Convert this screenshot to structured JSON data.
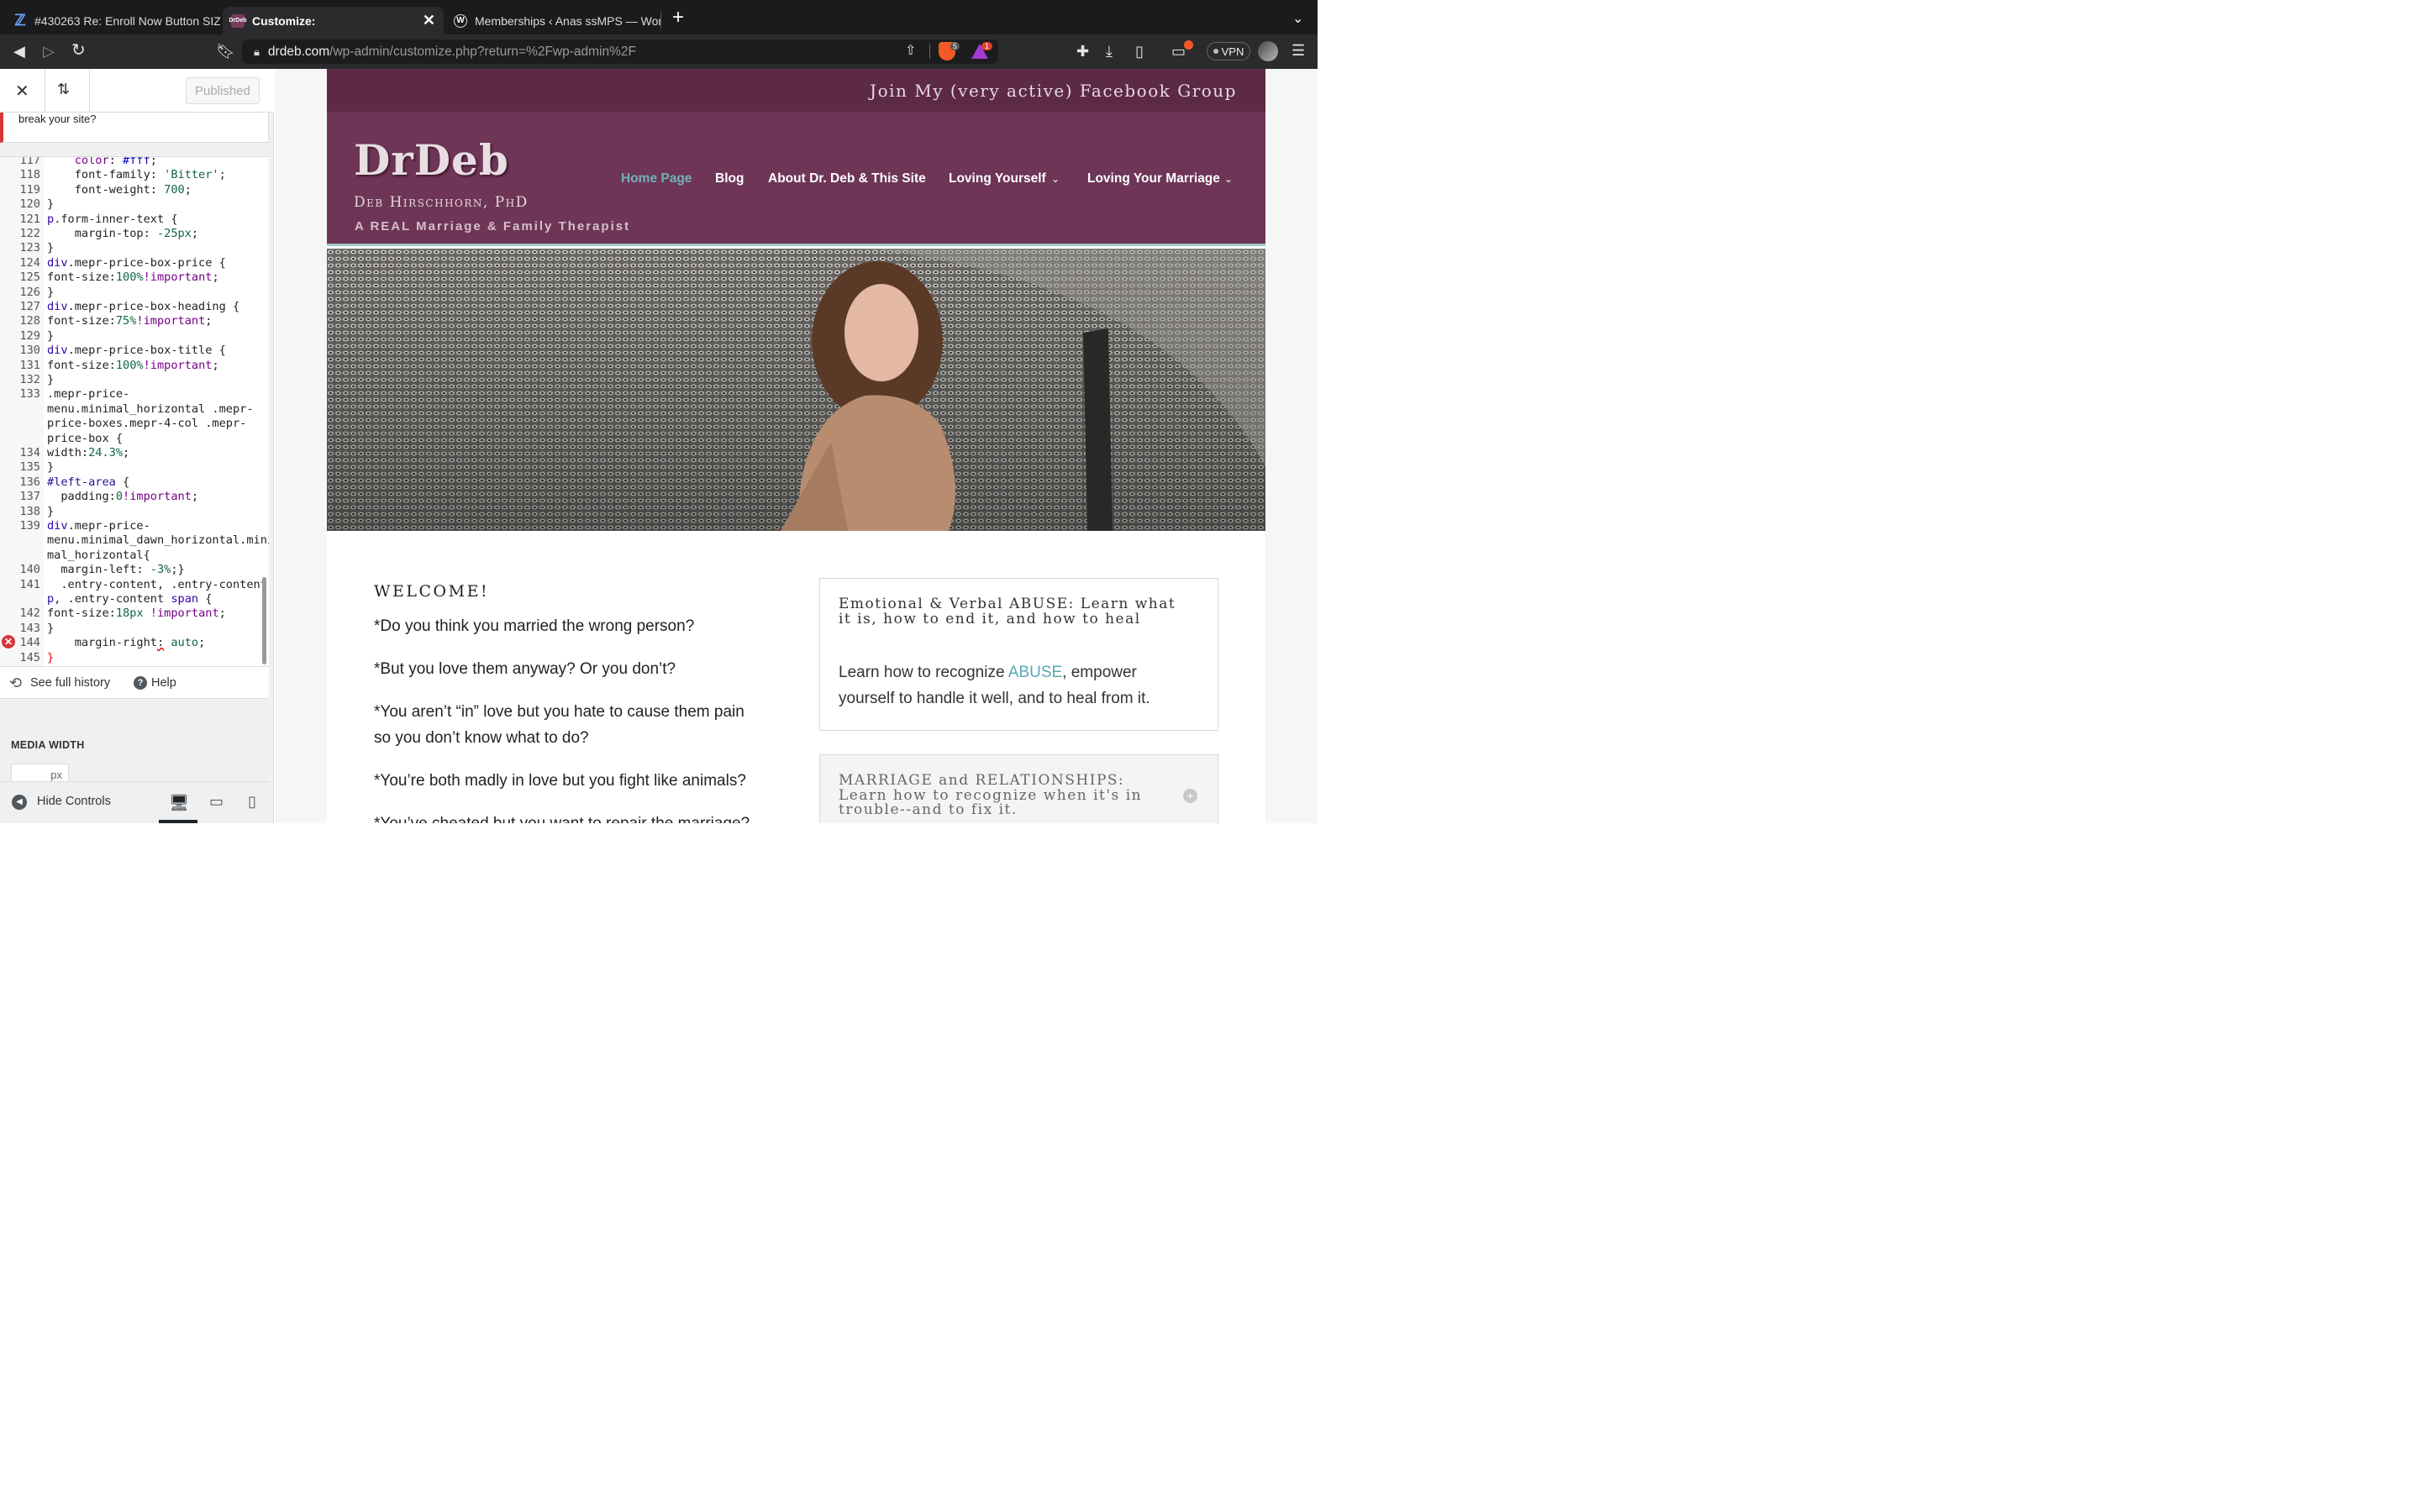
{
  "browser": {
    "tabs": [
      {
        "title": "#430263 Re: Enroll Now Button SIZ",
        "icon": "zendesk-icon"
      },
      {
        "title": "Customize:",
        "icon": "drdeb-favicon",
        "active": true
      },
      {
        "title": "Memberships ‹ Anas ssMPS — Word",
        "icon": "wordpress-icon"
      }
    ],
    "url_host": "drdeb.com",
    "url_path": "/wp-admin/customize.php?return=%2Fwp-admin%2F",
    "brave_shield_count": "5",
    "rewards_count": "1",
    "vpn_label": "VPN"
  },
  "customizer": {
    "published_label": "Published",
    "notice_text": "break your site?",
    "code_lines": [
      {
        "n": "117",
        "html": "    <span class='k'>color</span>: <span class='c'>#fff</span>;"
      },
      {
        "n": "118",
        "html": "    font-family: <span class='s'>'Bitter'</span>;"
      },
      {
        "n": "119",
        "html": "    font-weight: <span class='n'>700</span>;"
      },
      {
        "n": "120",
        "html": "}"
      },
      {
        "n": "121",
        "html": "<span class='t'>p</span>.form-inner-text {"
      },
      {
        "n": "122",
        "html": "    margin-top: <span class='n'>-25px</span>;"
      },
      {
        "n": "123",
        "html": "}"
      },
      {
        "n": "124",
        "html": "<span class='t'>div</span>.mepr-price-box-price {"
      },
      {
        "n": "125",
        "html": "font-size:<span class='n'>100%</span><span class='k'>!important</span>;"
      },
      {
        "n": "126",
        "html": "}"
      },
      {
        "n": "127",
        "html": "<span class='t'>div</span>.mepr-price-box-heading {"
      },
      {
        "n": "128",
        "html": "font-size:<span class='n'>75%</span><span class='k'>!important</span>;"
      },
      {
        "n": "129",
        "html": "}"
      },
      {
        "n": "130",
        "html": "<span class='t'>div</span>.mepr-price-box-title {"
      },
      {
        "n": "131",
        "html": "font-size:<span class='n'>100%</span><span class='k'>!important</span>;"
      },
      {
        "n": "132",
        "html": "}"
      },
      {
        "n": "133",
        "html": ".mepr-price-"
      },
      {
        "n": "",
        "html": "menu.minimal_horizontal .mepr-"
      },
      {
        "n": "",
        "html": "price-boxes.mepr-4-col .mepr-"
      },
      {
        "n": "",
        "html": "price-box {"
      },
      {
        "n": "134",
        "html": "width:<span class='n'>24.3%</span>;"
      },
      {
        "n": "135",
        "html": "}"
      },
      {
        "n": "136",
        "html": "<span class='v'>#left-area</span> {"
      },
      {
        "n": "137",
        "html": "  padding:<span class='n'>0</span><span class='k'>!important</span>;"
      },
      {
        "n": "138",
        "html": "}"
      },
      {
        "n": "139",
        "html": "<span class='t'>div</span>.mepr-price-"
      },
      {
        "n": "",
        "html": "menu.minimal_dawn_horizontal.mini"
      },
      {
        "n": "",
        "html": "mal_horizontal{"
      },
      {
        "n": "140",
        "html": "  margin-left: <span class='n'>-3%</span>;}"
      },
      {
        "n": "141",
        "html": "  .entry-content, .entry-content"
      },
      {
        "n": "",
        "html": "<span class='t'>p</span>, .entry-content <span class='t'>span</span> {"
      },
      {
        "n": "142",
        "html": "font-size:<span class='n'>18px</span> <span class='k'>!important</span>;"
      },
      {
        "n": "143",
        "html": "}"
      },
      {
        "n": "144",
        "html": "    margin-right<span style='text-decoration:underline wavy #d00'>:</span> <span class='s'>auto</span>;"
      },
      {
        "n": "145",
        "html": "<span style='color:#d00'>}</span>"
      }
    ],
    "history_label": "See full history",
    "help_label": "Help",
    "media_width_label": "MEDIA WIDTH",
    "media_width_unit": "px",
    "hide_controls_label": "Hide Controls"
  },
  "site": {
    "facebook_link": "Join My (very active) Facebook Group",
    "logo": "DrDeb",
    "author": "Deb Hirschhorn, PhD",
    "tagline": "A REAL Marriage & Family Therapist",
    "nav": [
      {
        "label": "Home Page",
        "active": true
      },
      {
        "label": "Blog"
      },
      {
        "label": "About Dr. Deb & This Site"
      },
      {
        "label": "Loving Yourself",
        "dropdown": true
      },
      {
        "label": "Loving Your Marriage",
        "dropdown": true
      }
    ],
    "welcome_title": "WELCOME!",
    "welcome_lines": [
      "*Do you think you married the wrong person?",
      "*But you love them anyway? Or you don’t?",
      "*You aren’t “in” love but you hate to cause them pain",
      "so you don’t know what to do?",
      "*You’re both madly in love but you fight like animals?",
      "*You’ve cheated but you want to repair the marriage?"
    ],
    "box1_title": "Emotional & Verbal ABUSE: Learn what it is, how to end it, and how to heal",
    "box1_text_before": "Learn how to recognize ",
    "box1_link": "ABUSE",
    "box1_text_after": ", empower yourself to handle it well, and to heal from it.",
    "box2_title": "MARRIAGE and RELATIONSHIPS: Learn how to recognize when it's in trouble--and to fix it.",
    "colors": {
      "header": "#6e3557",
      "strip": "#5c2a47",
      "accent": "#6fb3b8"
    }
  }
}
